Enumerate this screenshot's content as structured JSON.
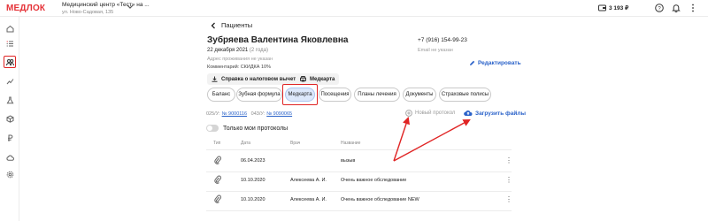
{
  "header": {
    "logo": "МЕДЛОК",
    "clinic_name": "Медицинский центр «Тест» на ...",
    "clinic_address": "ул. Ново-Садовая, 135",
    "balance": "3 193 ₽"
  },
  "sidebar": {
    "items": [
      "home",
      "list",
      "patients",
      "chart",
      "lab",
      "box",
      "wallet",
      "cloud",
      "settings"
    ],
    "active_index": 2
  },
  "patient": {
    "back_label": "Пациенты",
    "name": "Зубряева Валентина Яковлевна",
    "dob": "22 декабря 2021",
    "age": "(2 года)",
    "address": "Адрес проживания не указан",
    "comment": "Комментарий: СКИДКА 10%",
    "phone": "+7 (916) 154-99-23",
    "email": "Email не указан",
    "edit_label": "Редактировать",
    "tax_button": "Справка о налоговом вычете",
    "medcard_button": "Медкарта"
  },
  "tabs": [
    "Баланс",
    "Зубная формула",
    "Медкарта",
    "Посещения",
    "Планы лечения",
    "Документы",
    "Страховые полисы"
  ],
  "active_tab": "Медкарта",
  "forms": {
    "f1_label": "025/У:",
    "f1_value": "№ 9000116",
    "f2_label": "043/У:",
    "f2_value": "№ 9090065"
  },
  "actions": {
    "new_protocol": "Новый протокол",
    "upload": "Загрузить файлы",
    "toggle_label": "Только мои протоколы"
  },
  "table": {
    "headers": [
      "Тип",
      "Дата",
      "Врач",
      "Название"
    ],
    "rows": [
      {
        "date": "06.04.2023",
        "doctor": "",
        "title": "вызыв"
      },
      {
        "date": "10.10.2020",
        "doctor": "Алексеева А. И.",
        "title": "Очень важное обследование"
      },
      {
        "date": "10.10.2020",
        "doctor": "Алексеева А. И.",
        "title": "Очень важное обследование NEW"
      }
    ]
  },
  "colors": {
    "accent": "#2a62c9",
    "brand": "#e53238",
    "annotation": "#e02424"
  }
}
